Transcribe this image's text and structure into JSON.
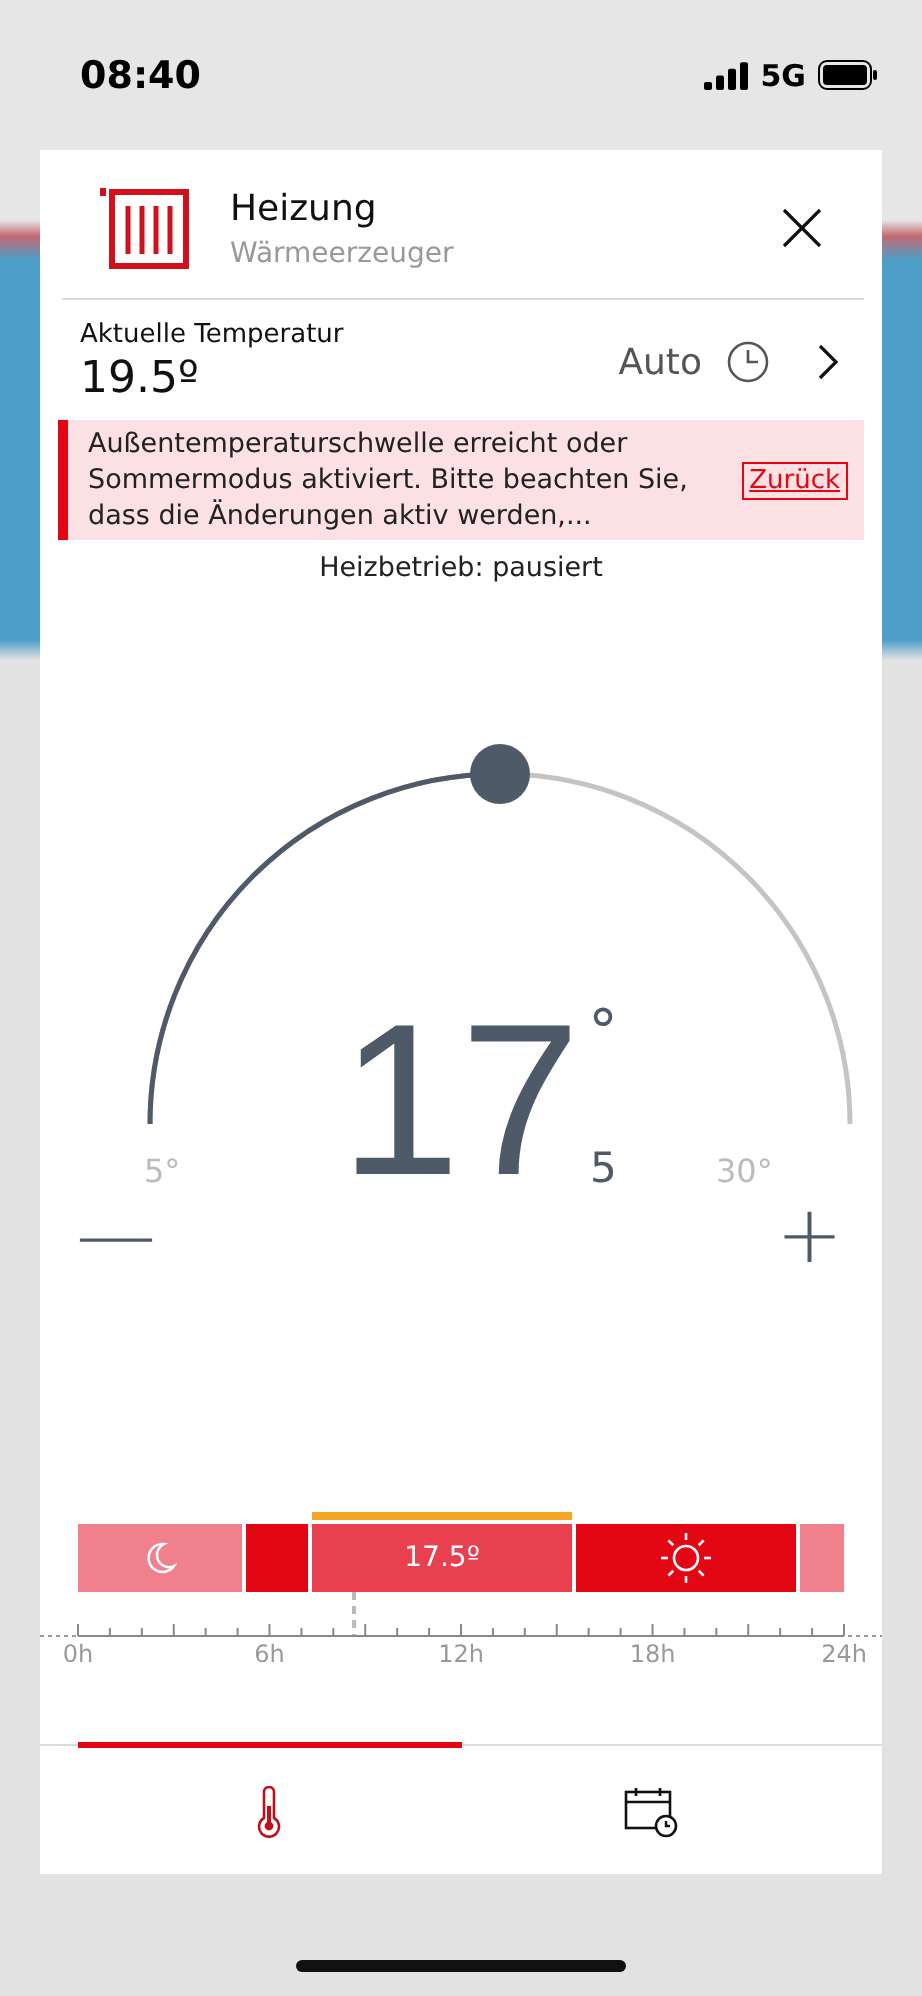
{
  "status_bar": {
    "time": "08:40",
    "network": "5G"
  },
  "header": {
    "title": "Heizung",
    "subtitle": "Wärmeerzeuger"
  },
  "current": {
    "label": "Aktuelle Temperatur",
    "value": "19.5º",
    "mode": "Auto"
  },
  "alert": {
    "text": "Außentemperaturschwelle erreicht oder Sommermodus aktiviert. Bitte beachten Sie, dass die Änderungen aktiv werden,...",
    "action": "Zurück"
  },
  "status": "Heizbetrieb: pausiert",
  "dial": {
    "whole": "17",
    "degree": "°",
    "decimal": "5",
    "min": "5°",
    "max": "30°",
    "minus": "—",
    "plus": "+"
  },
  "schedule": {
    "segments": [
      {
        "kind": "night",
        "selected": false
      },
      {
        "kind": "heat",
        "selected": false
      },
      {
        "kind": "setpoint",
        "label": "17.5º",
        "selected": true
      },
      {
        "kind": "day",
        "selected": false
      },
      {
        "kind": "night",
        "selected": false
      }
    ],
    "ticks": [
      "0h",
      "6h",
      "12h",
      "18h",
      "24h"
    ]
  },
  "tabs": [
    {
      "kind": "temperature",
      "selected": true
    },
    {
      "kind": "schedule",
      "selected": false
    }
  ]
}
